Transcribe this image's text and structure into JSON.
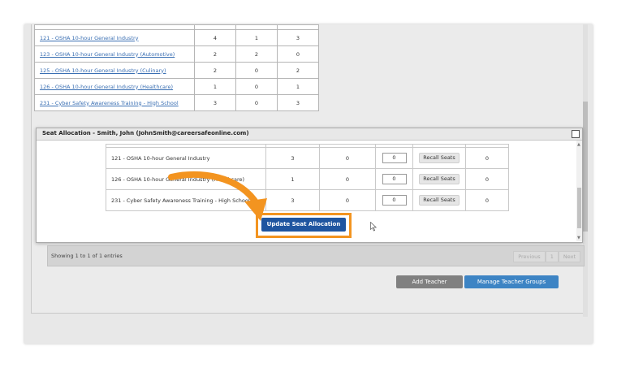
{
  "courses": [
    {
      "name": "121 - OSHA 10-hour General Industry",
      "a": "4",
      "b": "1",
      "c": "3"
    },
    {
      "name": "123 - OSHA 10-hour General Industry (Automotive)",
      "a": "2",
      "b": "2",
      "c": "0"
    },
    {
      "name": "125 - OSHA 10-hour General Industry (Culinary)",
      "a": "2",
      "b": "0",
      "c": "2"
    },
    {
      "name": "126 - OSHA 10-hour General Industry (Healthcare)",
      "a": "1",
      "b": "0",
      "c": "1"
    },
    {
      "name": "231 - Cyber Safety Awareness Training - High School",
      "a": "3",
      "b": "0",
      "c": "3"
    }
  ],
  "modal": {
    "title": "Seat Allocation - Smith, John (JohnSmith@careersafeonline.com)",
    "rows": [
      {
        "name": "121 - OSHA 10-hour General Industry",
        "total": "3",
        "used": "0",
        "input": "0",
        "recall": "Recall Seats",
        "avail": "0"
      },
      {
        "name": "126 - OSHA 10-hour General Industry (Healthcare)",
        "total": "1",
        "used": "0",
        "input": "0",
        "recall": "Recall Seats",
        "avail": "0"
      },
      {
        "name": "231 - Cyber Safety Awareness Training - High School",
        "total": "3",
        "used": "0",
        "input": "0",
        "recall": "Recall Seats",
        "avail": "0"
      }
    ],
    "update_label": "Update Seat Allocation"
  },
  "footer": {
    "info": "Showing 1 to 1 of 1 entries",
    "previous": "Previous",
    "page": "1",
    "next": "Next"
  },
  "buttons": {
    "add_teacher": "Add Teacher",
    "manage_groups": "Manage Teacher Groups"
  },
  "colors": {
    "highlight": "#f39420",
    "primary": "#1f55a0",
    "link": "#3a6fb3"
  }
}
